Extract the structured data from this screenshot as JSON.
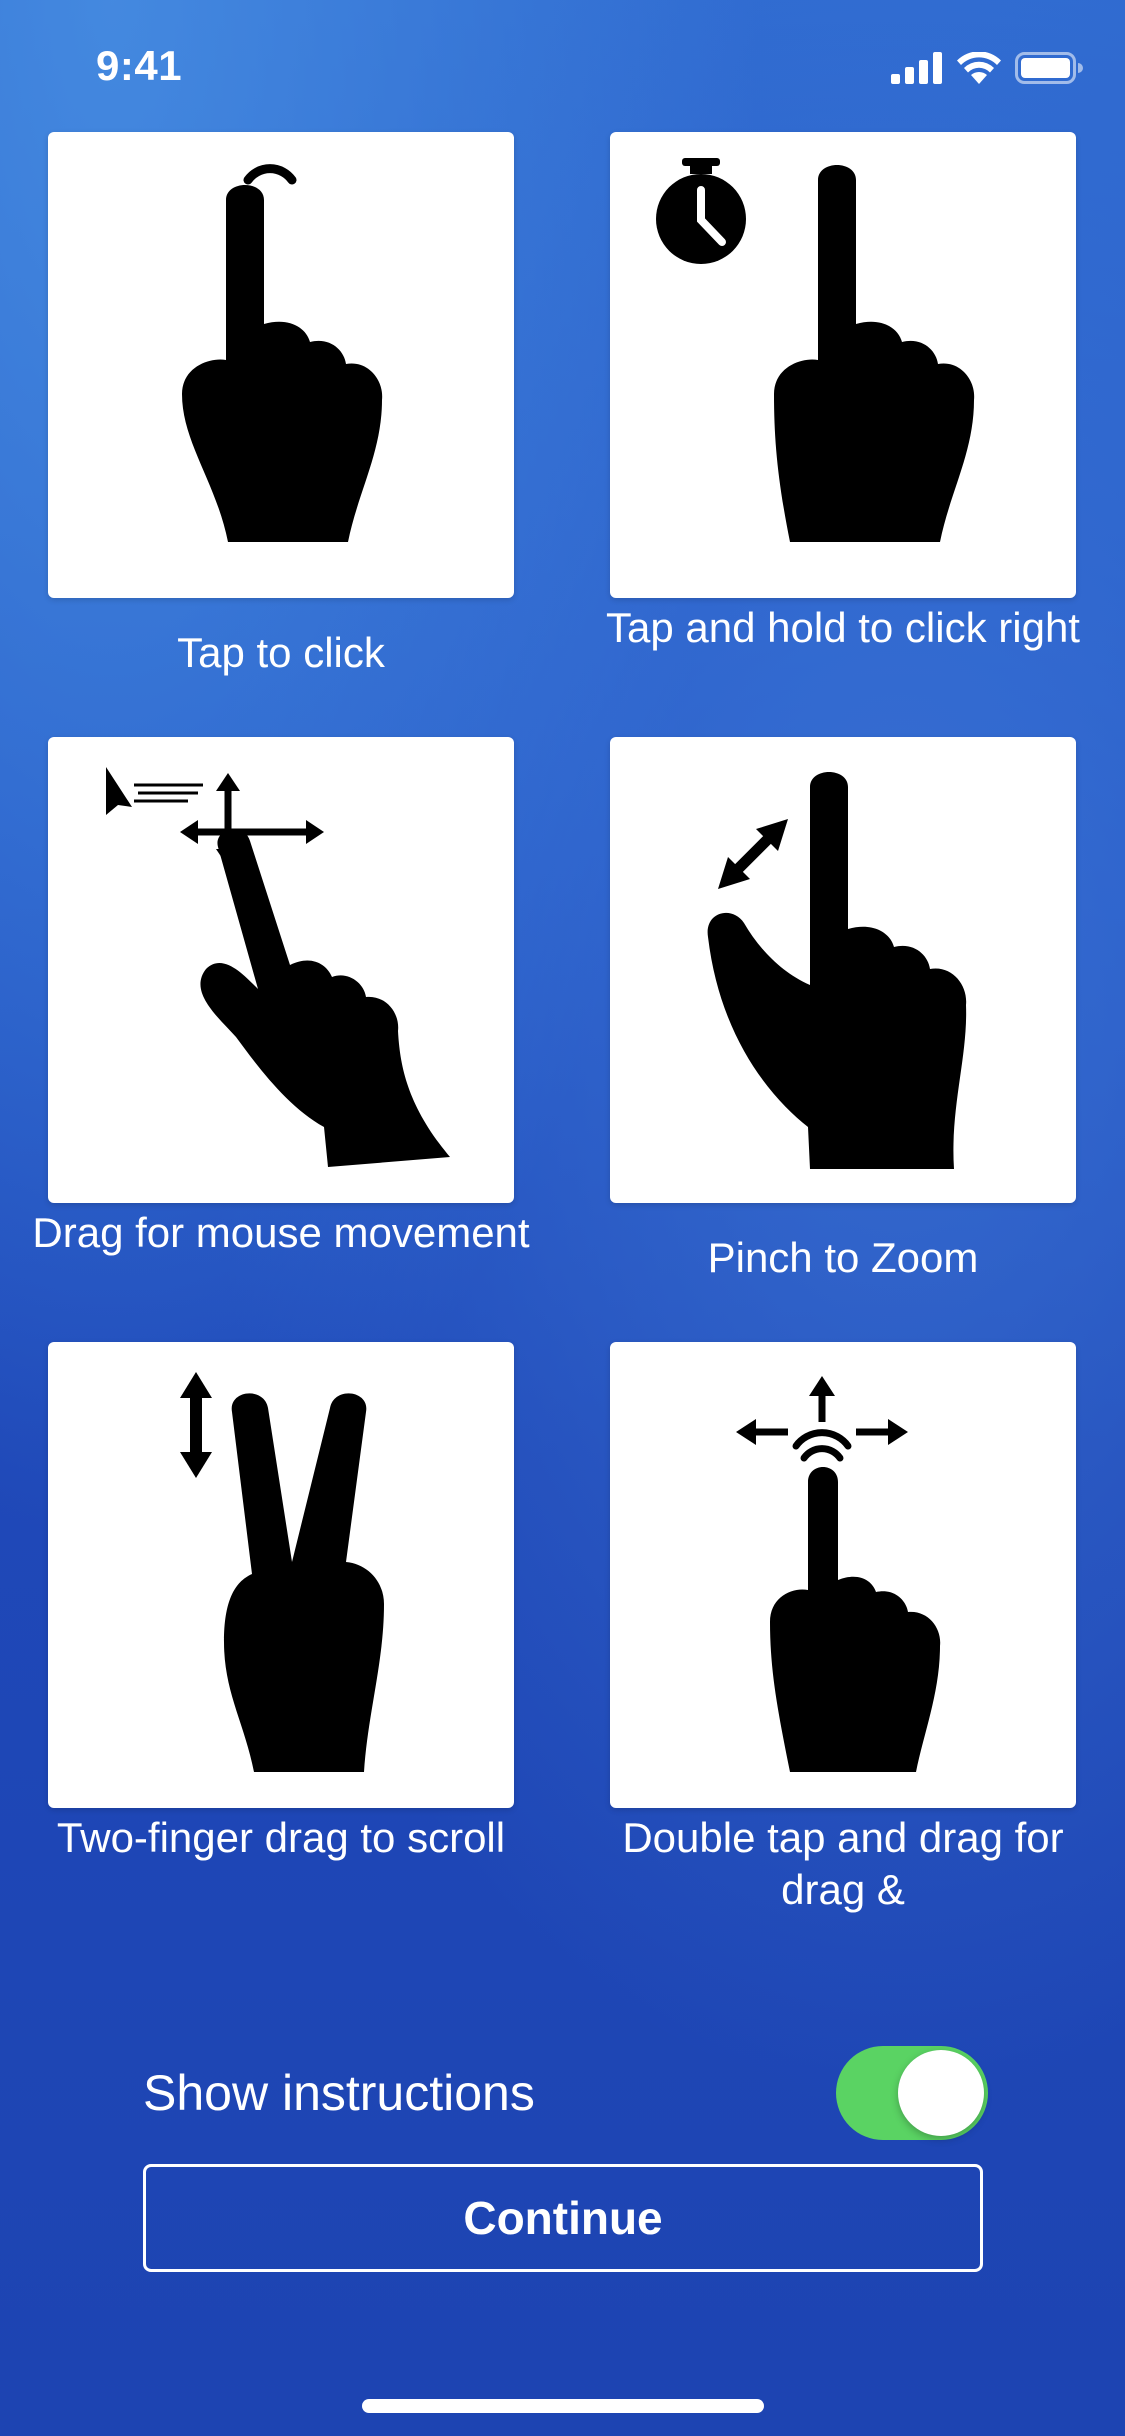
{
  "status_bar": {
    "time": "9:41",
    "icons": [
      "cellular-signal-icon",
      "wifi-icon",
      "battery-icon"
    ]
  },
  "gestures": [
    {
      "caption": "Tap to click",
      "icon": "tap-hand-icon"
    },
    {
      "caption": "Tap and hold to click right",
      "icon": "tap-and-hold-hand-icon"
    },
    {
      "caption": "Drag for mouse movement",
      "icon": "drag-hand-icon"
    },
    {
      "caption": "Pinch to Zoom",
      "icon": "pinch-hand-icon"
    },
    {
      "caption": "Two-finger drag to scroll",
      "icon": "two-finger-scroll-hand-icon"
    },
    {
      "caption": "Double tap and drag for drag &",
      "icon": "double-tap-drag-hand-icon"
    }
  ],
  "show_instructions": {
    "label": "Show instructions",
    "enabled": true
  },
  "continue_button": {
    "label": "Continue"
  },
  "colors": {
    "background": "#2456c6",
    "toggle_on": "#5ad363",
    "card": "#ffffff",
    "icon": "#000000"
  }
}
